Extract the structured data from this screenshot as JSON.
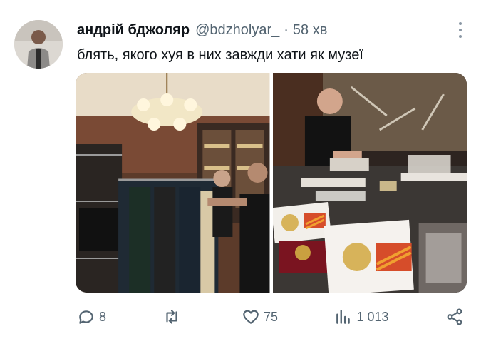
{
  "author": {
    "name": "андрій бджоляр",
    "handle": "@bdzholyar_",
    "separator": "·",
    "time": "58 хв"
  },
  "tweet": {
    "text": "блять, якого хуя в них завжди хати як музеї"
  },
  "media": [
    {
      "icon": "photo-wardrobe-room"
    },
    {
      "icon": "photo-desk-with-medals"
    }
  ],
  "actions": {
    "reply_count": "8",
    "retweet_count": "",
    "like_count": "75",
    "views_count": "1 013"
  },
  "colors": {
    "text": "#0f1419",
    "secondary": "#536471"
  }
}
